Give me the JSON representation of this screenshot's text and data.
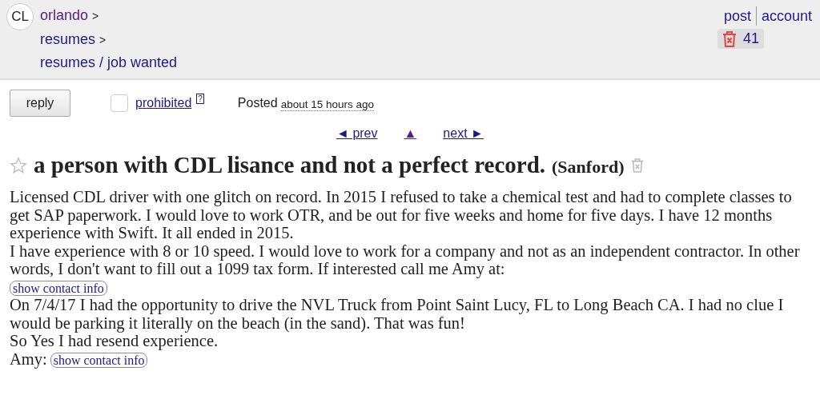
{
  "header": {
    "logo": "CL",
    "breadcrumbs": [
      {
        "label": "orlando",
        "separator": ">",
        "visited": true
      },
      {
        "label": "resumes",
        "separator": ">",
        "visited": false
      },
      {
        "label": "resumes / job wanted",
        "visited": false
      }
    ],
    "links": [
      {
        "label": "post"
      },
      {
        "label": "account"
      }
    ],
    "trash_count": "41"
  },
  "actions": {
    "reply": "reply",
    "prohibited": {
      "label": "prohibited",
      "help": "?",
      "checked": false
    },
    "posted_label": "Posted",
    "posted_time": "about 15 hours ago"
  },
  "nav": {
    "prev": "◄ prev",
    "up": "▲",
    "next": "next ►"
  },
  "post": {
    "favorite": false,
    "title": "a person with CDL lisance and not a perfect record.",
    "location": "(Sanford)",
    "body": [
      [
        {
          "kind": "text",
          "text": "Licensed CDL driver with one glitch on record. In 2015 I refused to take a chemical test and had to complete classes to get SAP paperwork. I would love to work OTR, and be out for five weeks and home for five days. I have 12 months experience with Swift. It all ended in 2015."
        }
      ],
      [
        {
          "kind": "text",
          "text": "I have experience with 8 or 10 speed. I would love to work for a company and not as an independent contractor. In other words, I don't want to fill out a 1099 tax form. If interested call me Amy at:"
        }
      ],
      [
        {
          "kind": "contact",
          "text": "show contact info"
        }
      ],
      [
        {
          "kind": "text",
          "text": "On 7/4/17 I had the opportunity to drive the NVL Truck from Point Saint Lucy, FL to Long Beach CA. I had no clue I would be parking it literally on the beach (in the sand). That was fun!"
        }
      ],
      [
        {
          "kind": "text",
          "text": "So Yes I had resend experience."
        }
      ],
      [
        {
          "kind": "text",
          "text": "Amy:"
        },
        {
          "kind": "contact",
          "text": "show contact info"
        }
      ]
    ]
  }
}
